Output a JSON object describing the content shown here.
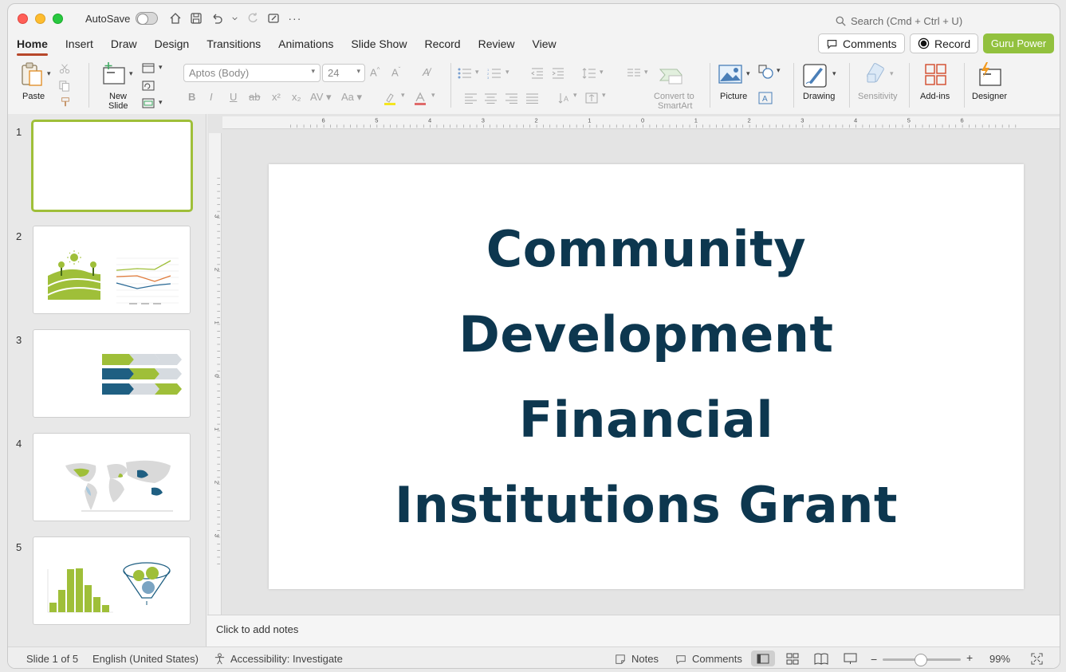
{
  "titlebar": {
    "autosave_label": "AutoSave",
    "search_placeholder": "Search (Cmd + Ctrl + U)"
  },
  "tabs": [
    "Home",
    "Insert",
    "Draw",
    "Design",
    "Transitions",
    "Animations",
    "Slide Show",
    "Record",
    "Review",
    "View"
  ],
  "header_buttons": {
    "comments": "Comments",
    "record": "Record",
    "guru": "Guru Power"
  },
  "ribbon": {
    "paste": "Paste",
    "new_slide_1": "New",
    "new_slide_2": "Slide",
    "font_name": "Aptos (Body)",
    "font_size": "24",
    "convert_1": "Convert to",
    "convert_2": "SmartArt",
    "picture": "Picture",
    "drawing": "Drawing",
    "sensitivity": "Sensitivity",
    "addins": "Add-ins",
    "designer": "Designer"
  },
  "thumbnails": [
    {
      "num": "1"
    },
    {
      "num": "2"
    },
    {
      "num": "3"
    },
    {
      "num": "4"
    },
    {
      "num": "5"
    }
  ],
  "ruler": {
    "h_labels": [
      "6",
      "5",
      "4",
      "3",
      "2",
      "1",
      "0",
      "1",
      "2",
      "3",
      "4",
      "5",
      "6"
    ],
    "v_labels": [
      "3",
      "2",
      "1",
      "0",
      "1",
      "2",
      "3"
    ]
  },
  "slide": {
    "title": "Community Development Financial Institutions Grant"
  },
  "notes_placeholder": "Click to add notes",
  "status": {
    "slide_count": "Slide 1 of 5",
    "language": "English (United States)",
    "accessibility": "Accessibility: Investigate",
    "notes": "Notes",
    "comments": "Comments",
    "zoom": "99%"
  },
  "colors": {
    "accent_tab": "#b7472a",
    "guru_green": "#92c13e",
    "title_navy": "#0d374f",
    "thumb_green": "#9fbf39"
  }
}
